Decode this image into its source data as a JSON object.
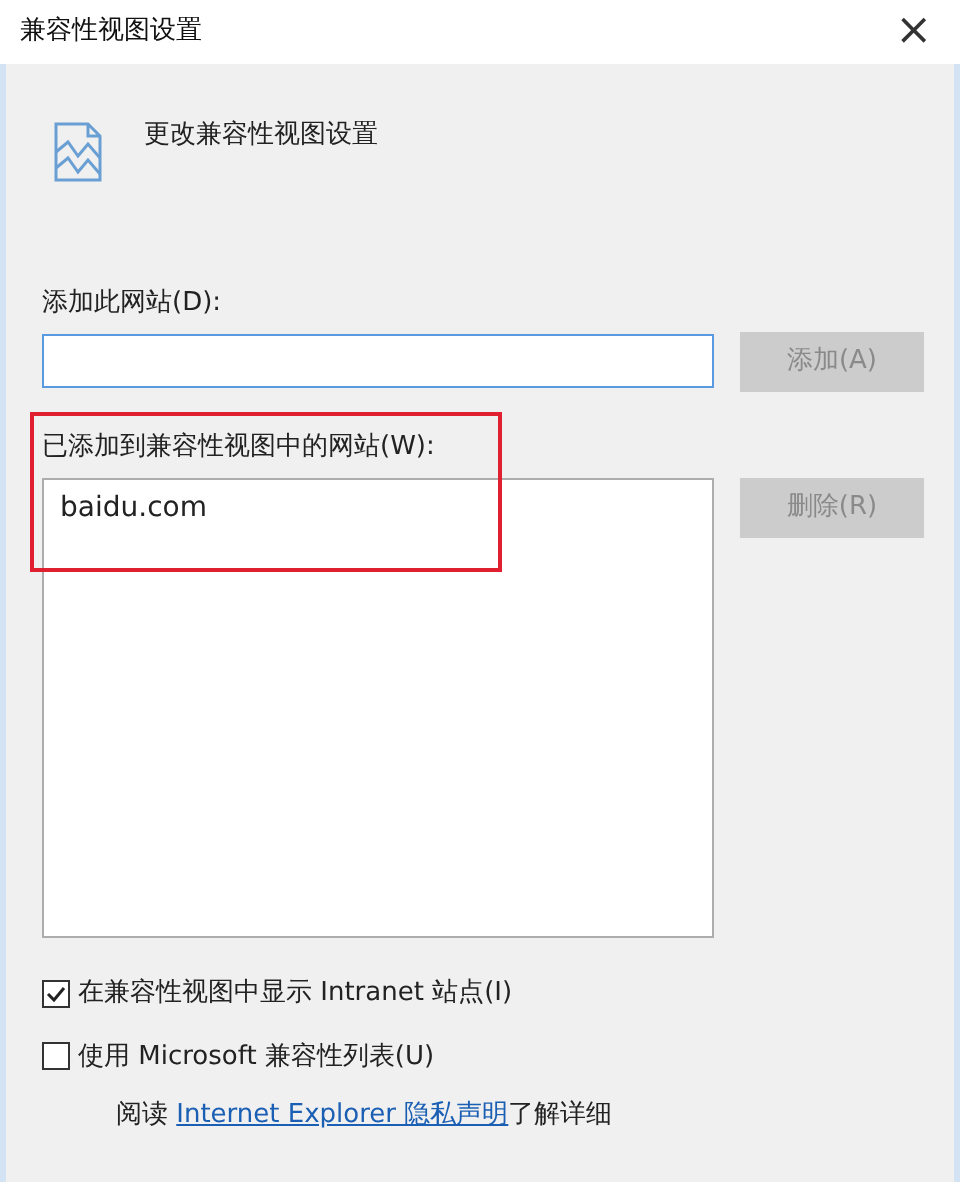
{
  "window": {
    "title": "兼容性视图设置",
    "close": "×"
  },
  "heading": "更改兼容性视图设置",
  "add_site": {
    "label": "添加此网站(D):",
    "focused": true,
    "button": {
      "label": "添加(A)",
      "disabled": true
    }
  },
  "sites": {
    "label": "已添加到兼容性视图中的网站(W):",
    "highlighted": true,
    "items": [
      {
        "text": "baidu.com",
        "selected": false
      }
    ],
    "button": {
      "label": "删除(R)",
      "disabled": true
    }
  },
  "options": [
    {
      "label": "在兼容性视图中显示 Intranet 站点(I)",
      "checked": true
    },
    {
      "label": "使用 Microsoft 兼容性列表(U)",
      "checked": false
    }
  ],
  "privacy": {
    "prefix": "阅读 ",
    "link": "Internet Explorer 隐私声明",
    "suffix": "了解详细"
  }
}
